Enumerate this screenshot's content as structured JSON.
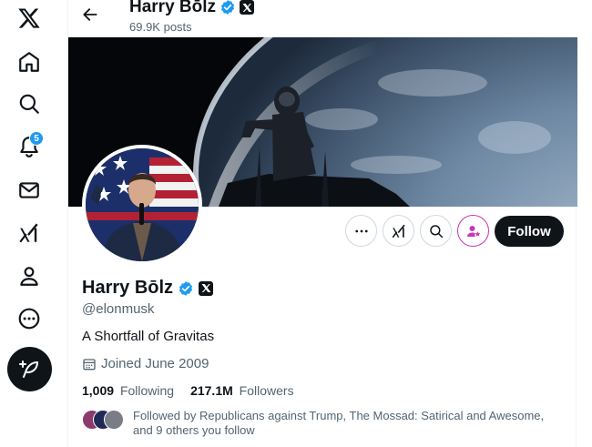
{
  "header": {
    "name": "Harry Bōlz",
    "posts_count": "69.9K posts"
  },
  "nav": {
    "items": [
      {
        "icon": "x-logo-icon"
      },
      {
        "icon": "home-icon"
      },
      {
        "icon": "search-icon"
      },
      {
        "icon": "notifications-icon"
      },
      {
        "icon": "messages-icon"
      },
      {
        "icon": "grok-icon"
      },
      {
        "icon": "profile-icon"
      },
      {
        "icon": "more-icon"
      }
    ],
    "notification_count": "5",
    "post_icon": "feather-plus-icon"
  },
  "profile": {
    "name": "Harry Bōlz",
    "handle": "@elonmusk",
    "bio": "A Shortfall of Gravitas",
    "joined": "Joined June 2009",
    "following_count": "1,009",
    "following_label": "Following",
    "followers_count": "217.1M",
    "followers_label": "Followers",
    "followed_by": "Followed by Republicans against Trump, The Mossad: Satirical and Awesome, and 9 others you follow"
  },
  "actions": {
    "follow_label": "Follow"
  },
  "colors": {
    "accent": "#1d9bf0",
    "text": "#0f1419",
    "muted": "#536471",
    "subscribe": "#c936b8"
  }
}
